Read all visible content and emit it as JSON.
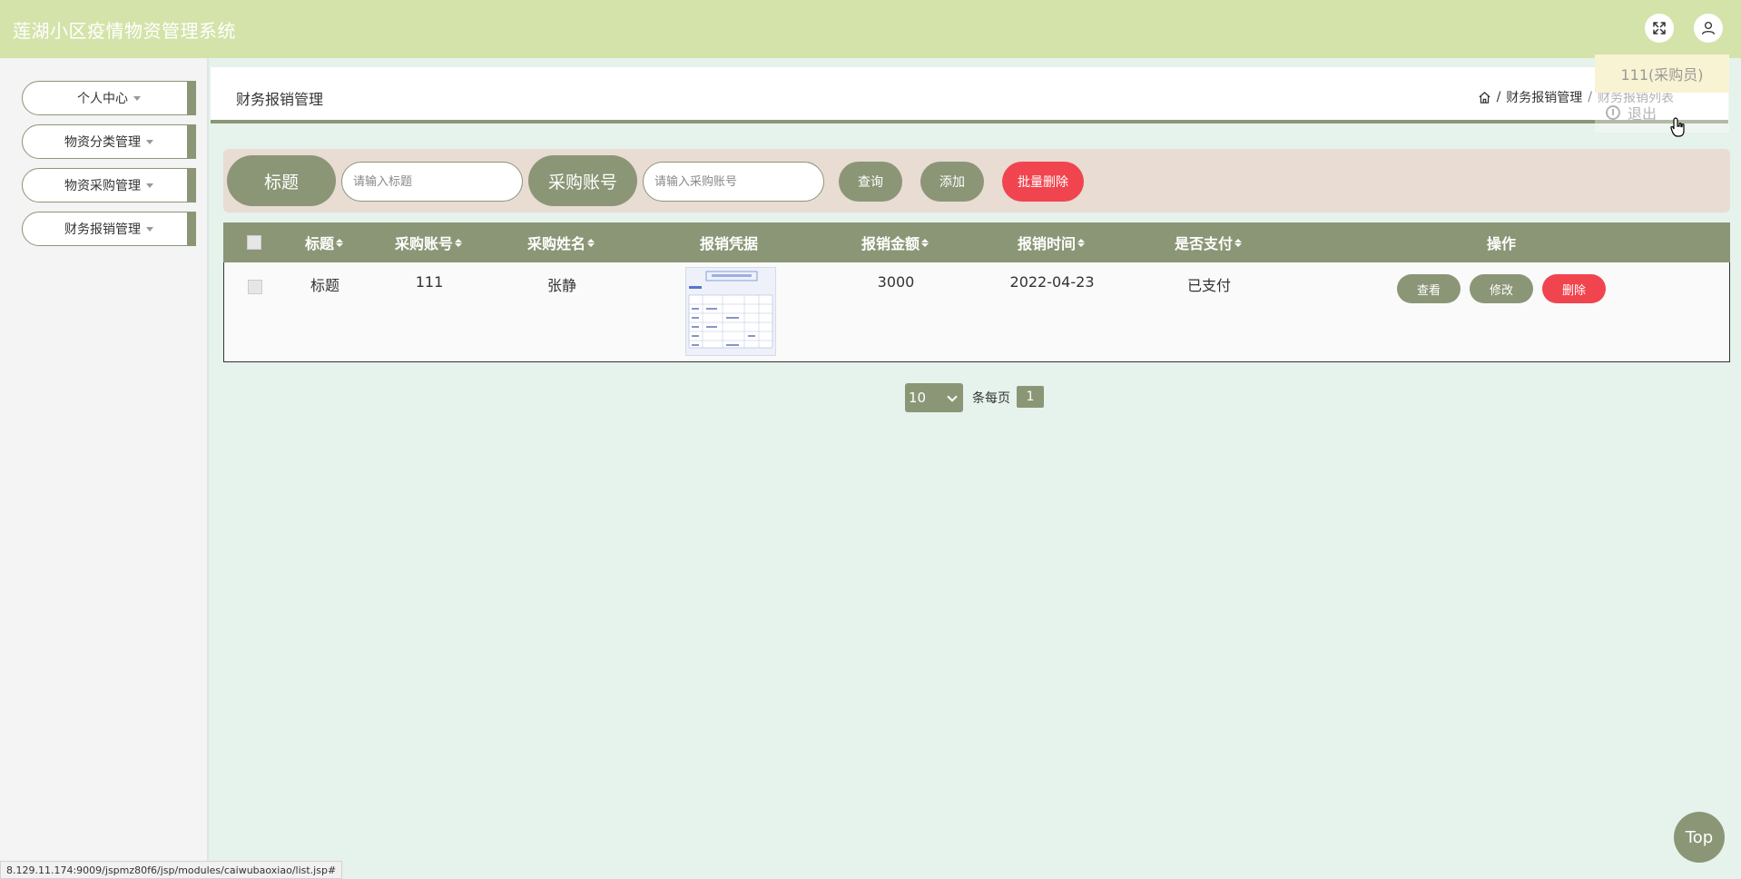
{
  "header": {
    "app_title": "莲湖小区疫情物资管理系统",
    "fullscreen_icon": "expand-icon",
    "user_icon": "user-icon"
  },
  "user_menu": {
    "username": "111(采购员)",
    "logout_label": "退出"
  },
  "sidebar": {
    "items": [
      {
        "label": "个人中心"
      },
      {
        "label": "物资分类管理"
      },
      {
        "label": "物资采购管理"
      },
      {
        "label": "财务报销管理"
      }
    ]
  },
  "page": {
    "title": "财务报销管理",
    "breadcrumb": {
      "section": "财务报销管理",
      "separator": "/",
      "current": "财务报销列表"
    }
  },
  "search": {
    "title_label": "标题",
    "title_placeholder": "请输入标题",
    "account_label": "采购账号",
    "account_placeholder": "请输入采购账号",
    "query_button": "查询",
    "add_button": "添加",
    "batch_delete_button": "批量删除"
  },
  "table": {
    "columns": [
      "标题",
      "采购账号",
      "采购姓名",
      "报销凭据",
      "报销金额",
      "报销时间",
      "是否支付",
      "操作"
    ],
    "rows": [
      {
        "title": "标题",
        "account": "111",
        "name": "张静",
        "amount": "3000",
        "time": "2022-04-23",
        "paid": "已支付",
        "view": "查看",
        "edit": "修改",
        "delete": "删除"
      }
    ]
  },
  "pager": {
    "page_size": "10",
    "per_page_label": "条每页",
    "current_page": "1"
  },
  "top_button": "Top",
  "status_url": "8.129.11.174:9009/jspmz80f6/jsp/modules/caiwubaoxiao/list.jsp#",
  "colors": {
    "header_bg": "#d4e3aa",
    "accent": "#8b9676",
    "danger": "#f0454f",
    "search_bg": "#e8dcd3",
    "page_bg": "#e6f2ec"
  }
}
